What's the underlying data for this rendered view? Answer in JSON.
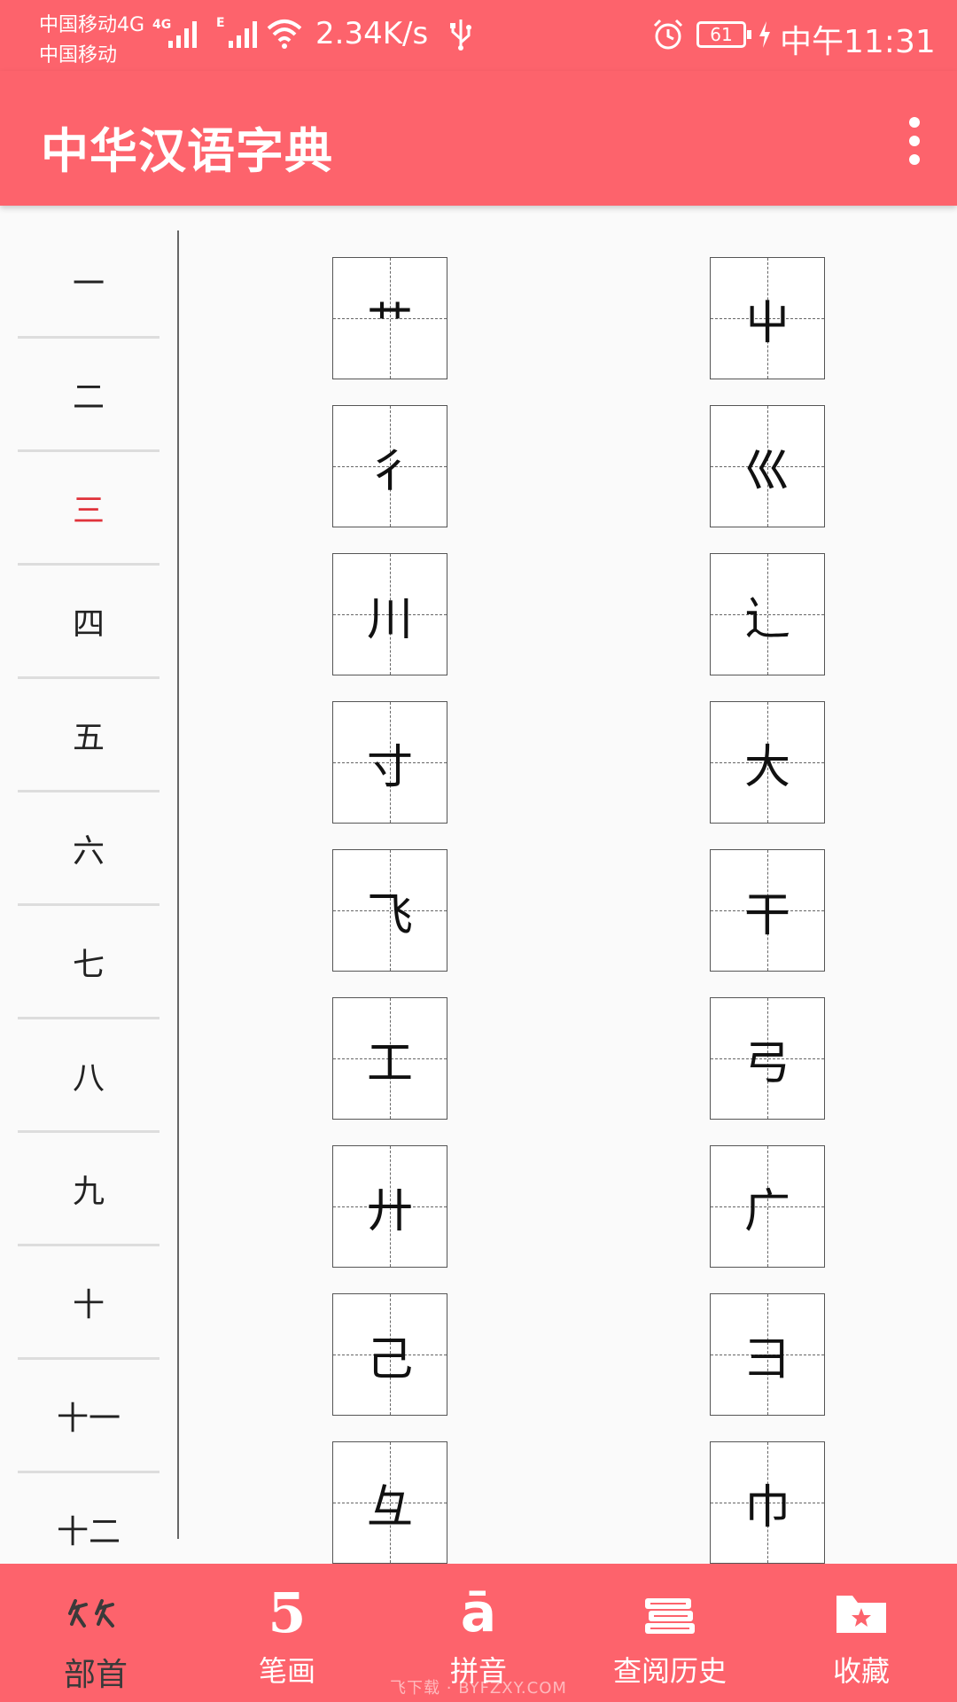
{
  "status_bar": {
    "carrier_1": "中国移动4G",
    "carrier_2": "中国移动",
    "net_4g": "4G",
    "net_e": "E",
    "speed": "2.34K/s",
    "battery": "61",
    "time": "中午11:31"
  },
  "app_bar": {
    "title": "中华汉语字典"
  },
  "stroke_list": {
    "items": [
      "一",
      "二",
      "三",
      "四",
      "五",
      "六",
      "七",
      "八",
      "九",
      "十",
      "十一",
      "十二"
    ],
    "active_index": 2
  },
  "radicals": [
    [
      "艹",
      "屮"
    ],
    [
      "彳",
      "巛"
    ],
    [
      "川",
      "辶"
    ],
    [
      "寸",
      "大"
    ],
    [
      "飞",
      "干"
    ],
    [
      "工",
      "弓"
    ],
    [
      "廾",
      "广"
    ],
    [
      "己",
      "彐"
    ],
    [
      "彑",
      "巾"
    ]
  ],
  "bottom_nav": {
    "items": [
      {
        "label": "部首",
        "icon": "radical-icon"
      },
      {
        "label": "笔画",
        "icon": "five-icon",
        "glyph": "5"
      },
      {
        "label": "拼音",
        "icon": "pinyin-icon",
        "glyph": "ā"
      },
      {
        "label": "查阅历史",
        "icon": "books-icon"
      },
      {
        "label": "收藏",
        "icon": "folder-star-icon"
      }
    ],
    "active_index": 0
  },
  "watermark": "飞下载 · BYFZXY.COM",
  "colors": {
    "primary": "#fd636c",
    "active_text": "#e0323a",
    "nav_active_label": "#3a3a3a"
  }
}
